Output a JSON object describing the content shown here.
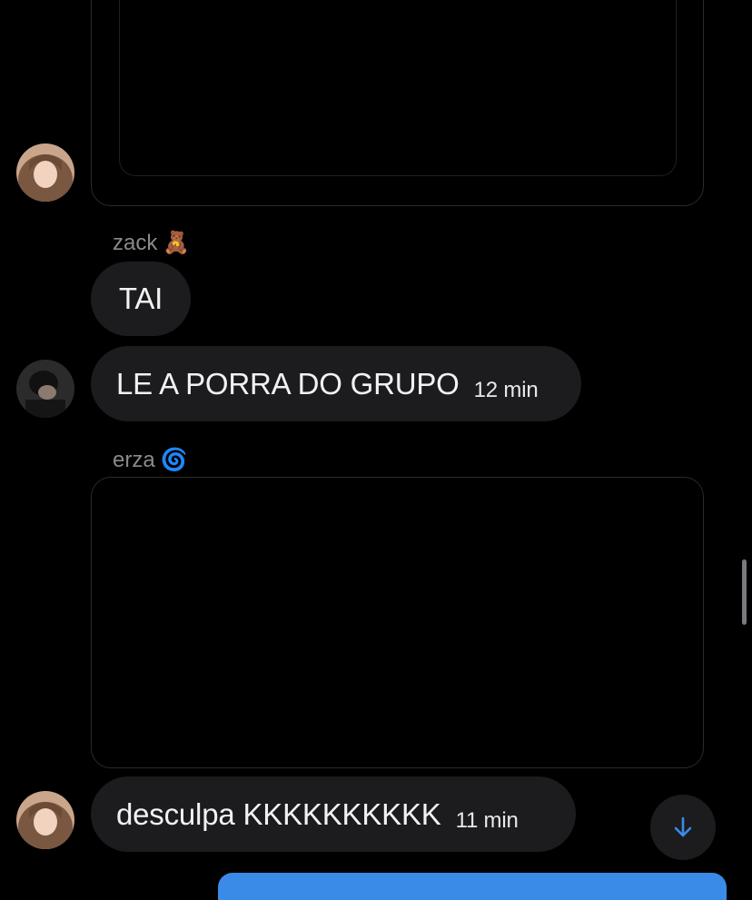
{
  "messages": [
    {
      "sender": "zack",
      "sender_emoji": "🧸",
      "text": "TAI"
    },
    {
      "text": "LE A PORRA DO GRUPO",
      "time": "12 min"
    },
    {
      "sender": "erza",
      "sender_emoji": "🌀"
    },
    {
      "text": "desculpa KKKKKKKKKK",
      "time": "11 min"
    }
  ],
  "icons": {
    "scroll_down": "arrow-down-icon"
  },
  "colors": {
    "background": "#000000",
    "bubble": "#1c1c1f",
    "accent": "#3a8be8",
    "muted": "#8a8a8e"
  }
}
